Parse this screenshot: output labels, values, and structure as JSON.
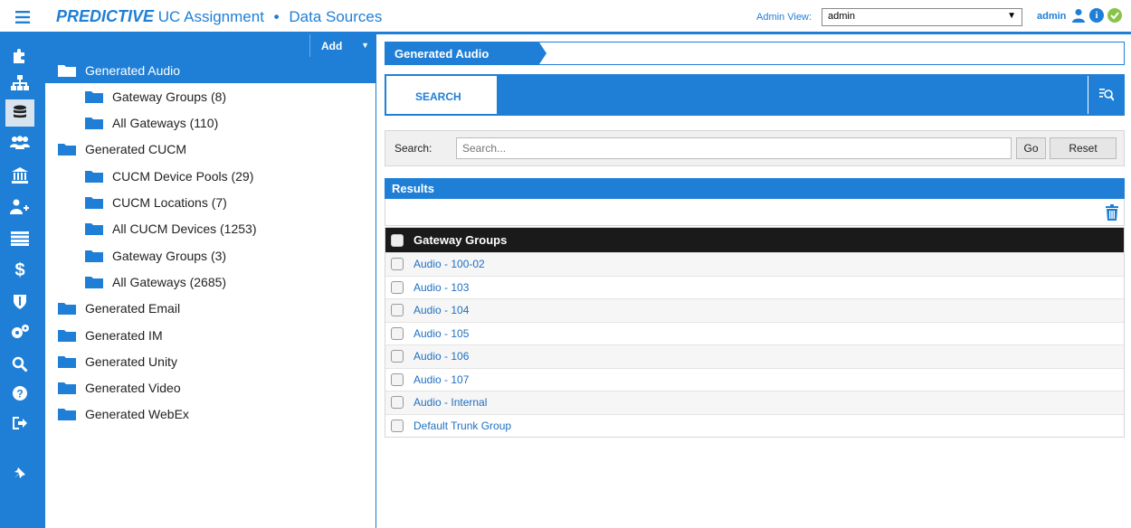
{
  "header": {
    "brand": "PREDICTIVE",
    "product": "UC Assignment",
    "separator": "•",
    "page": "Data Sources",
    "admin_view_label": "Admin View:",
    "admin_view_value": "admin",
    "user": "admin",
    "accent_color": "#1f7fd6"
  },
  "rail": {
    "icons": [
      "puzzle-icon",
      "sitemap-icon",
      "database-icon",
      "users-icon",
      "building-icon",
      "add-user-icon",
      "list-icon",
      "dollar-icon",
      "shield-icon",
      "cogs-icon",
      "search-icon",
      "help-icon",
      "logout-icon",
      "pin-icon"
    ],
    "active_index": 2
  },
  "tree": {
    "add_label": "Add",
    "items": [
      {
        "label": "Generated Audio",
        "level": 0,
        "selected": true
      },
      {
        "label": "Gateway Groups (8)",
        "level": 1
      },
      {
        "label": "All Gateways (110)",
        "level": 1
      },
      {
        "label": "Generated CUCM",
        "level": 0
      },
      {
        "label": "CUCM Device Pools (29)",
        "level": 1
      },
      {
        "label": "CUCM Locations (7)",
        "level": 1
      },
      {
        "label": "All CUCM Devices (1253)",
        "level": 1
      },
      {
        "label": "Gateway Groups (3)",
        "level": 1
      },
      {
        "label": "All Gateways (2685)",
        "level": 1
      },
      {
        "label": "Generated Email",
        "level": 0
      },
      {
        "label": "Generated IM",
        "level": 0
      },
      {
        "label": "Generated Unity",
        "level": 0
      },
      {
        "label": "Generated Video",
        "level": 0
      },
      {
        "label": "Generated WebEx",
        "level": 0
      }
    ]
  },
  "main": {
    "breadcrumb": "Generated Audio",
    "tab_search": "SEARCH",
    "search_label": "Search:",
    "search_placeholder": "Search...",
    "go_label": "Go",
    "reset_label": "Reset",
    "results_label": "Results",
    "column_header": "Gateway Groups",
    "rows": [
      "Audio - 100-02",
      "Audio - 103",
      "Audio - 104",
      "Audio - 105",
      "Audio - 106",
      "Audio - 107",
      "Audio - Internal",
      "Default Trunk Group"
    ]
  }
}
